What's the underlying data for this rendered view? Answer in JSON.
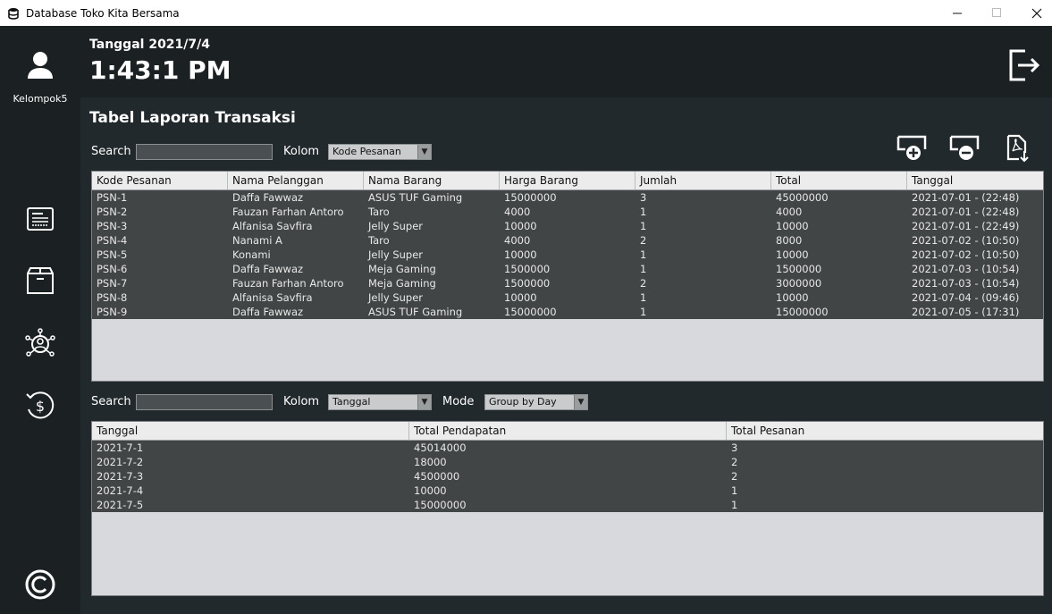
{
  "window": {
    "title": "Database Toko Kita Bersama"
  },
  "colors": {
    "sidebar_bg": "#1b2023",
    "main_bg": "#21292c",
    "row_bg": "#414545"
  },
  "sidebar": {
    "user_label": "Kelompok5",
    "items": [
      {
        "icon": "report-icon"
      },
      {
        "icon": "box-icon"
      },
      {
        "icon": "customer-network-icon"
      },
      {
        "icon": "money-history-icon"
      }
    ],
    "footer_icon": "copyright-icon"
  },
  "header": {
    "date": "Tanggal 2021/7/4",
    "time": "1:43:1 PM"
  },
  "main": {
    "title": "Tabel Laporan Transaksi",
    "top": {
      "search_label": "Search",
      "search_value": "",
      "kolom_label": "Kolom",
      "kolom_selected": "Kode Pesanan",
      "toolbar_icons": [
        "add-icon",
        "remove-icon",
        "export-pdf-icon"
      ],
      "columns": [
        "Kode Pesanan",
        "Nama Pelanggan",
        "Nama Barang",
        "Harga Barang",
        "Jumlah",
        "Total",
        "Tanggal"
      ],
      "rows": [
        [
          "PSN-1",
          "Daffa Fawwaz",
          "ASUS TUF Gaming",
          "15000000",
          "3",
          "45000000",
          "2021-07-01 - (22:48)"
        ],
        [
          "PSN-2",
          "Fauzan Farhan Antoro",
          "Taro",
          "4000",
          "1",
          "4000",
          "2021-07-01 - (22:48)"
        ],
        [
          "PSN-3",
          "Alfanisa Savfira",
          "Jelly Super",
          "10000",
          "1",
          "10000",
          "2021-07-01 - (22:49)"
        ],
        [
          "PSN-4",
          "Nanami A",
          "Taro",
          "4000",
          "2",
          "8000",
          "2021-07-02 - (10:50)"
        ],
        [
          "PSN-5",
          "Konami",
          "Jelly Super",
          "10000",
          "1",
          "10000",
          "2021-07-02 - (10:50)"
        ],
        [
          "PSN-6",
          "Daffa Fawwaz",
          "Meja Gaming",
          "1500000",
          "1",
          "1500000",
          "2021-07-03 - (10:54)"
        ],
        [
          "PSN-7",
          "Fauzan Farhan Antoro",
          "Meja Gaming",
          "1500000",
          "2",
          "3000000",
          "2021-07-03 - (10:54)"
        ],
        [
          "PSN-8",
          "Alfanisa Savfira",
          "Jelly Super",
          "10000",
          "1",
          "10000",
          "2021-07-04 - (09:46)"
        ],
        [
          "PSN-9",
          "Daffa Fawwaz",
          "ASUS TUF Gaming",
          "15000000",
          "1",
          "15000000",
          "2021-07-05 - (17:31)"
        ]
      ]
    },
    "bottom": {
      "search_label": "Search",
      "search_value": "",
      "kolom_label": "Kolom",
      "kolom_selected": "Tanggal",
      "mode_label": "Mode",
      "mode_selected": "Group by Day",
      "columns": [
        "Tanggal",
        "Total Pendapatan",
        "Total Pesanan"
      ],
      "rows": [
        [
          "2021-7-1",
          "45014000",
          "3"
        ],
        [
          "2021-7-2",
          "18000",
          "2"
        ],
        [
          "2021-7-3",
          "4500000",
          "2"
        ],
        [
          "2021-7-4",
          "10000",
          "1"
        ],
        [
          "2021-7-5",
          "15000000",
          "1"
        ]
      ]
    }
  }
}
